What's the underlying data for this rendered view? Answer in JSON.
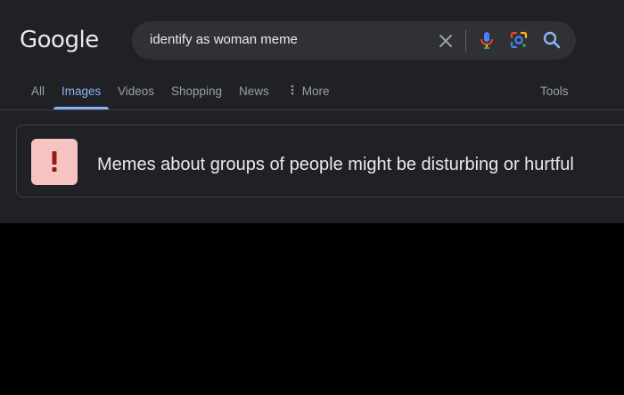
{
  "logo": {
    "text": "Google"
  },
  "search": {
    "query": "identify as woman meme"
  },
  "tabs": [
    {
      "label": "All"
    },
    {
      "label": "Images"
    },
    {
      "label": "Videos"
    },
    {
      "label": "Shopping"
    },
    {
      "label": "News"
    },
    {
      "label": "More"
    }
  ],
  "tools": {
    "label": "Tools"
  },
  "warning": {
    "message": "Memes about groups of people might be disturbing or hurtful",
    "icon": "exclamation-icon",
    "icon_bg": "#f6c3c3",
    "icon_color": "#8c1d18"
  },
  "colors": {
    "background": "#202124",
    "search_bg": "#303134",
    "accent": "#8ab4f8",
    "text": "#e8eaed",
    "muted": "#9aa0a6"
  },
  "icons": [
    "close-icon",
    "mic-icon",
    "lens-icon",
    "search-icon",
    "more-vert-icon"
  ]
}
